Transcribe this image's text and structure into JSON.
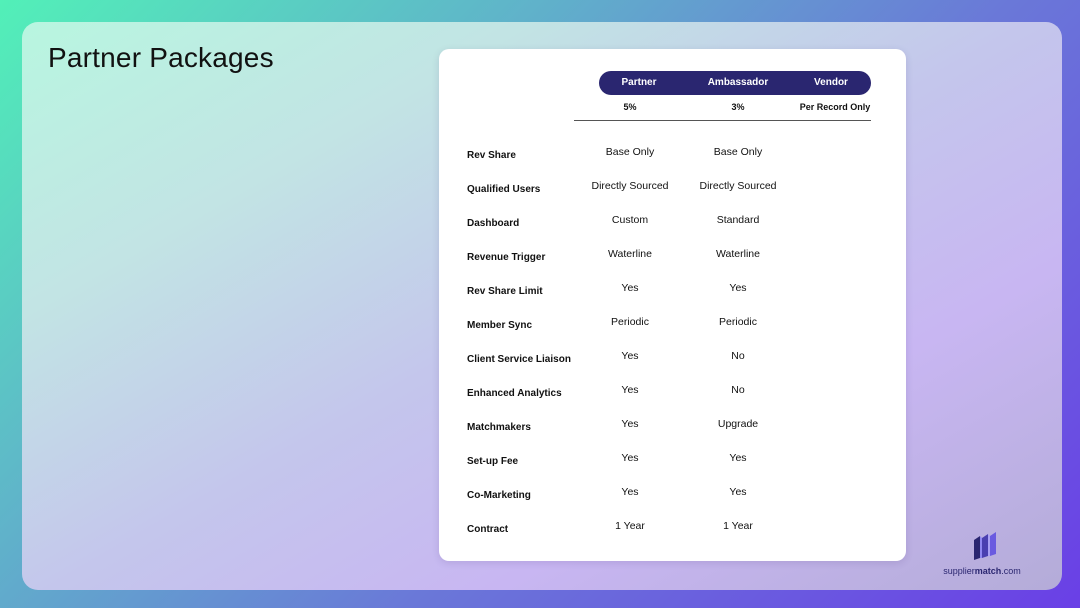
{
  "slide": {
    "title": "Partner Packages"
  },
  "table": {
    "columns": [
      {
        "name": "Partner",
        "rate": "5%"
      },
      {
        "name": "Ambassador",
        "rate": "3%"
      },
      {
        "name": "Vendor",
        "rate": "Per Record Only"
      }
    ],
    "rows": [
      {
        "label": "Rev Share",
        "partner": "Base Only",
        "ambassador": "Base Only",
        "vendor": ""
      },
      {
        "label": "Qualified Users",
        "partner": "Directly Sourced",
        "ambassador": "Directly Sourced",
        "vendor": ""
      },
      {
        "label": "Dashboard",
        "partner": "Custom",
        "ambassador": "Standard",
        "vendor": ""
      },
      {
        "label": "Revenue Trigger",
        "partner": "Waterline",
        "ambassador": "Waterline",
        "vendor": ""
      },
      {
        "label": "Rev Share Limit",
        "partner": "Yes",
        "ambassador": "Yes",
        "vendor": ""
      },
      {
        "label": "Member Sync",
        "partner": "Periodic",
        "ambassador": "Periodic",
        "vendor": ""
      },
      {
        "label": "Client Service Liaison",
        "partner": "Yes",
        "ambassador": "No",
        "vendor": ""
      },
      {
        "label": "Enhanced Analytics",
        "partner": "Yes",
        "ambassador": "No",
        "vendor": ""
      },
      {
        "label": "Matchmakers",
        "partner": "Yes",
        "ambassador": "Upgrade",
        "vendor": ""
      },
      {
        "label": "Set-up Fee",
        "partner": "Yes",
        "ambassador": "Yes",
        "vendor": ""
      },
      {
        "label": "Co-Marketing",
        "partner": "Yes",
        "ambassador": "Yes",
        "vendor": ""
      },
      {
        "label": "Contract",
        "partner": "1 Year",
        "ambassador": "1 Year",
        "vendor": ""
      }
    ]
  },
  "brand": {
    "logo_prefix": "supplier",
    "logo_bold": "match",
    "logo_suffix": ".com",
    "logo_icon": "suppliermatch-logo-icon"
  },
  "colors": {
    "header_pill": "#2a2670",
    "accent_purple": "#6a3fe6",
    "accent_teal": "#52f0b8"
  }
}
